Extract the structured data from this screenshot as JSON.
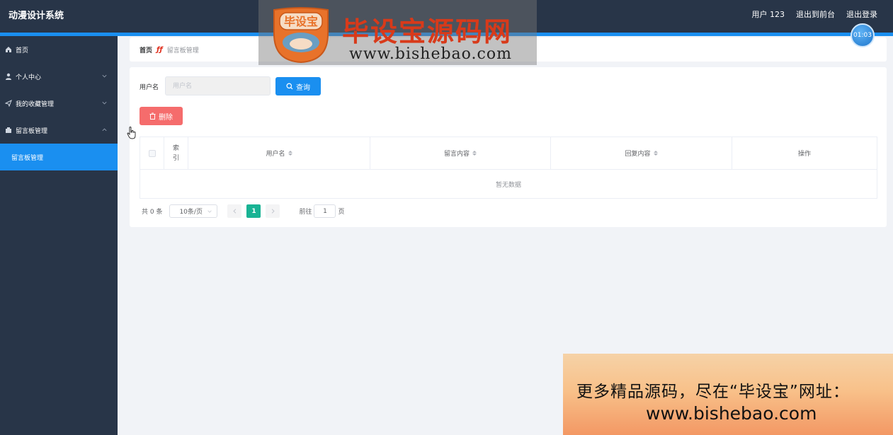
{
  "app": {
    "title": "动漫设计系统"
  },
  "header": {
    "user": "用户 123",
    "front_link": "退出到前台",
    "logout": "退出登录"
  },
  "sidebar": {
    "items": [
      {
        "label": "首页",
        "icon": "home-icon"
      },
      {
        "label": "个人中心",
        "icon": "user-icon",
        "expandable": true
      },
      {
        "label": "我的收藏管理",
        "icon": "send-icon",
        "expandable": true
      },
      {
        "label": "留言板管理",
        "icon": "box-icon",
        "expandable": true,
        "expanded": true
      },
      {
        "label": "留言板管理",
        "sub": true,
        "active": true
      }
    ]
  },
  "breadcrumb": {
    "home": "首页",
    "current": "留言板管理"
  },
  "filter": {
    "label": "用户名",
    "placeholder": "用户名",
    "search_label": "查询"
  },
  "actions": {
    "delete_label": "删除"
  },
  "table": {
    "headers": {
      "index": [
        "索",
        "引"
      ],
      "username": "用户名",
      "message": "留言内容",
      "reply": "回复内容",
      "operation": "操作"
    },
    "empty_text": "暂无数据"
  },
  "pagination": {
    "total": "共 0 条",
    "page_size": "10条/页",
    "current_page": "1",
    "goto_label": "前往",
    "goto_value": "1",
    "page_unit": "页"
  },
  "watermark": {
    "logo_text": "毕设宝",
    "title": "毕设宝源码网",
    "url": "www.bishebao.com"
  },
  "timer": {
    "value": "01:03"
  },
  "ad": {
    "line1": "更多精品源码，尽在“毕设宝”网址：",
    "line2": "www.bishebao.com"
  },
  "colors": {
    "primary": "#1a8ff0",
    "sidebar_bg": "#283548",
    "danger": "#f56c6c",
    "page_active": "#19b394",
    "brand_red": "#d83a1a"
  }
}
